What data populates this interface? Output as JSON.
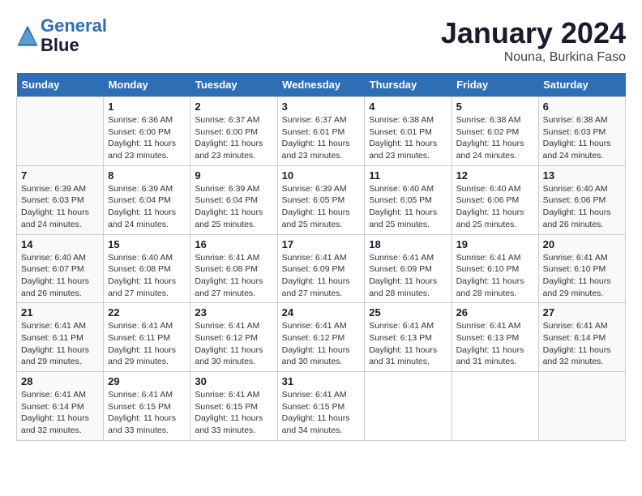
{
  "logo": {
    "line1": "General",
    "line2": "Blue"
  },
  "title": "January 2024",
  "subtitle": "Nouna, Burkina Faso",
  "weekdays": [
    "Sunday",
    "Monday",
    "Tuesday",
    "Wednesday",
    "Thursday",
    "Friday",
    "Saturday"
  ],
  "weeks": [
    [
      {
        "day": "",
        "detail": ""
      },
      {
        "day": "1",
        "detail": "Sunrise: 6:36 AM\nSunset: 6:00 PM\nDaylight: 11 hours\nand 23 minutes."
      },
      {
        "day": "2",
        "detail": "Sunrise: 6:37 AM\nSunset: 6:00 PM\nDaylight: 11 hours\nand 23 minutes."
      },
      {
        "day": "3",
        "detail": "Sunrise: 6:37 AM\nSunset: 6:01 PM\nDaylight: 11 hours\nand 23 minutes."
      },
      {
        "day": "4",
        "detail": "Sunrise: 6:38 AM\nSunset: 6:01 PM\nDaylight: 11 hours\nand 23 minutes."
      },
      {
        "day": "5",
        "detail": "Sunrise: 6:38 AM\nSunset: 6:02 PM\nDaylight: 11 hours\nand 24 minutes."
      },
      {
        "day": "6",
        "detail": "Sunrise: 6:38 AM\nSunset: 6:03 PM\nDaylight: 11 hours\nand 24 minutes."
      }
    ],
    [
      {
        "day": "7",
        "detail": "Sunrise: 6:39 AM\nSunset: 6:03 PM\nDaylight: 11 hours\nand 24 minutes."
      },
      {
        "day": "8",
        "detail": "Sunrise: 6:39 AM\nSunset: 6:04 PM\nDaylight: 11 hours\nand 24 minutes."
      },
      {
        "day": "9",
        "detail": "Sunrise: 6:39 AM\nSunset: 6:04 PM\nDaylight: 11 hours\nand 25 minutes."
      },
      {
        "day": "10",
        "detail": "Sunrise: 6:39 AM\nSunset: 6:05 PM\nDaylight: 11 hours\nand 25 minutes."
      },
      {
        "day": "11",
        "detail": "Sunrise: 6:40 AM\nSunset: 6:05 PM\nDaylight: 11 hours\nand 25 minutes."
      },
      {
        "day": "12",
        "detail": "Sunrise: 6:40 AM\nSunset: 6:06 PM\nDaylight: 11 hours\nand 25 minutes."
      },
      {
        "day": "13",
        "detail": "Sunrise: 6:40 AM\nSunset: 6:06 PM\nDaylight: 11 hours\nand 26 minutes."
      }
    ],
    [
      {
        "day": "14",
        "detail": "Sunrise: 6:40 AM\nSunset: 6:07 PM\nDaylight: 11 hours\nand 26 minutes."
      },
      {
        "day": "15",
        "detail": "Sunrise: 6:40 AM\nSunset: 6:08 PM\nDaylight: 11 hours\nand 27 minutes."
      },
      {
        "day": "16",
        "detail": "Sunrise: 6:41 AM\nSunset: 6:08 PM\nDaylight: 11 hours\nand 27 minutes."
      },
      {
        "day": "17",
        "detail": "Sunrise: 6:41 AM\nSunset: 6:09 PM\nDaylight: 11 hours\nand 27 minutes."
      },
      {
        "day": "18",
        "detail": "Sunrise: 6:41 AM\nSunset: 6:09 PM\nDaylight: 11 hours\nand 28 minutes."
      },
      {
        "day": "19",
        "detail": "Sunrise: 6:41 AM\nSunset: 6:10 PM\nDaylight: 11 hours\nand 28 minutes."
      },
      {
        "day": "20",
        "detail": "Sunrise: 6:41 AM\nSunset: 6:10 PM\nDaylight: 11 hours\nand 29 minutes."
      }
    ],
    [
      {
        "day": "21",
        "detail": "Sunrise: 6:41 AM\nSunset: 6:11 PM\nDaylight: 11 hours\nand 29 minutes."
      },
      {
        "day": "22",
        "detail": "Sunrise: 6:41 AM\nSunset: 6:11 PM\nDaylight: 11 hours\nand 29 minutes."
      },
      {
        "day": "23",
        "detail": "Sunrise: 6:41 AM\nSunset: 6:12 PM\nDaylight: 11 hours\nand 30 minutes."
      },
      {
        "day": "24",
        "detail": "Sunrise: 6:41 AM\nSunset: 6:12 PM\nDaylight: 11 hours\nand 30 minutes."
      },
      {
        "day": "25",
        "detail": "Sunrise: 6:41 AM\nSunset: 6:13 PM\nDaylight: 11 hours\nand 31 minutes."
      },
      {
        "day": "26",
        "detail": "Sunrise: 6:41 AM\nSunset: 6:13 PM\nDaylight: 11 hours\nand 31 minutes."
      },
      {
        "day": "27",
        "detail": "Sunrise: 6:41 AM\nSunset: 6:14 PM\nDaylight: 11 hours\nand 32 minutes."
      }
    ],
    [
      {
        "day": "28",
        "detail": "Sunrise: 6:41 AM\nSunset: 6:14 PM\nDaylight: 11 hours\nand 32 minutes."
      },
      {
        "day": "29",
        "detail": "Sunrise: 6:41 AM\nSunset: 6:15 PM\nDaylight: 11 hours\nand 33 minutes."
      },
      {
        "day": "30",
        "detail": "Sunrise: 6:41 AM\nSunset: 6:15 PM\nDaylight: 11 hours\nand 33 minutes."
      },
      {
        "day": "31",
        "detail": "Sunrise: 6:41 AM\nSunset: 6:15 PM\nDaylight: 11 hours\nand 34 minutes."
      },
      {
        "day": "",
        "detail": ""
      },
      {
        "day": "",
        "detail": ""
      },
      {
        "day": "",
        "detail": ""
      }
    ]
  ]
}
